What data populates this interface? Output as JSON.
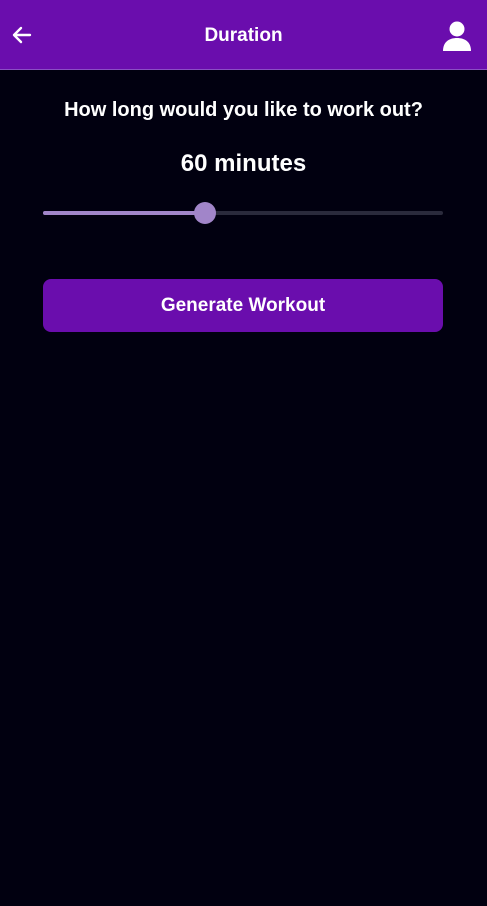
{
  "header": {
    "title": "Duration",
    "back_icon": "arrow-left-icon",
    "profile_icon": "user-icon"
  },
  "main": {
    "question": "How long would you like to work out?",
    "duration_value": "60 minutes",
    "slider": {
      "value_fraction": 0.405
    },
    "generate_button_label": "Generate Workout"
  },
  "colors": {
    "background": "#010010",
    "header": "#6a0dad",
    "accent": "#a185c9",
    "button": "#6a0dad",
    "track": "#2a2a3c"
  }
}
